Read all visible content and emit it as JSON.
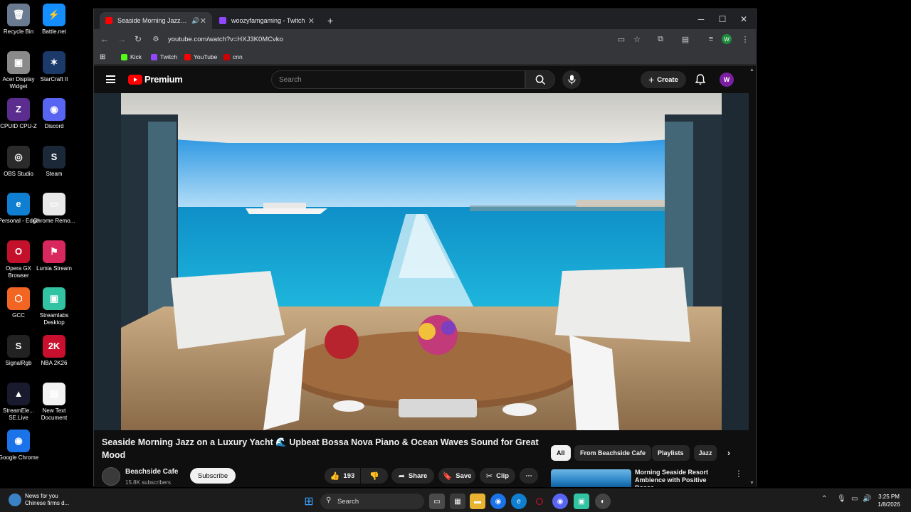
{
  "desktop_icons": [
    {
      "label": "Recycle Bin",
      "glyph": "🗑",
      "color": "#6a7a90"
    },
    {
      "label": "Battle.net",
      "glyph": "⚡",
      "color": "#148eff"
    },
    {
      "label": "Acer Display Widget",
      "glyph": "▣",
      "color": "#8a8a8a"
    },
    {
      "label": "StarCraft II",
      "glyph": "✶",
      "color": "#1b3a6a"
    },
    {
      "label": "CPUID CPU-Z",
      "glyph": "Z",
      "color": "#5b2d8e"
    },
    {
      "label": "Discord",
      "glyph": "◉",
      "color": "#5865f2"
    },
    {
      "label": "OBS Studio",
      "glyph": "◎",
      "color": "#2b2b2b"
    },
    {
      "label": "Steam",
      "glyph": "S",
      "color": "#1b2838"
    },
    {
      "label": "Personal - Edge",
      "glyph": "e",
      "color": "#0e7fd1"
    },
    {
      "label": "Chrome Remo...",
      "glyph": "▭",
      "color": "#e8e8e8"
    },
    {
      "label": "Opera GX Browser",
      "glyph": "O",
      "color": "#c3102b"
    },
    {
      "label": "Lumia Stream",
      "glyph": "⚑",
      "color": "#d9285e"
    },
    {
      "label": "GCC",
      "glyph": "⬡",
      "color": "#f26522"
    },
    {
      "label": "Streamlabs Desktop",
      "glyph": "▣",
      "color": "#31c3a2"
    },
    {
      "label": "SignalRgb",
      "glyph": "S",
      "color": "#222"
    },
    {
      "label": "NBA 2K26",
      "glyph": "2K",
      "color": "#c8102e"
    },
    {
      "label": "StreamEle... SE.Live",
      "glyph": "▲",
      "color": "#1a1a2e"
    },
    {
      "label": "New Text Document",
      "glyph": "▤",
      "color": "#f2f2f2"
    },
    {
      "label": "Google Chrome",
      "glyph": "◉",
      "color": "#1a73e8"
    }
  ],
  "browser": {
    "tabs": [
      {
        "title": "Seaside Morning Jazz on a",
        "favicon_color": "#ff0000",
        "active": true,
        "audio_icon": "speaker-icon"
      },
      {
        "title": "woozyfamgaming - Twitch",
        "favicon_color": "#9146ff",
        "active": false
      }
    ],
    "new_tab_label": "+",
    "url": "youtube.com/watch?v=HXJ3K0MCvko",
    "profile_letter": "W",
    "bookmarks": [
      {
        "label": "Kick",
        "color": "#53fc18"
      },
      {
        "label": "Twitch",
        "color": "#9146ff"
      },
      {
        "label": "YouTube",
        "color": "#ff0000"
      },
      {
        "label": "cnn",
        "color": "#cc0000"
      }
    ]
  },
  "youtube": {
    "logo_text": "Premium",
    "search_placeholder": "Search",
    "create_label": "Create",
    "avatar_letter": "W",
    "video_title": "Seaside Morning Jazz on a Luxury Yacht 🌊 Upbeat Bossa Nova Piano & Ocean Waves Sound for Great Mood",
    "channel_name": "Beachside Cafe",
    "subscribers": "15.8K subscribers",
    "subscribe_label": "Subscribe",
    "likes": "193",
    "share_label": "Share",
    "save_label": "Save",
    "clip_label": "Clip",
    "chips": [
      "All",
      "From Beachside Cafe",
      "Playlists",
      "Jazz"
    ],
    "recommendation_title": "Morning Seaside Resort Ambience with Positive Bossa"
  },
  "taskbar": {
    "news_title": "News for you",
    "news_subtitle": "Chinese firms d...",
    "search_label": "Search",
    "time": "3:25 PM",
    "date": "1/8/2026"
  },
  "colors": {
    "yt_red": "#ff0000",
    "yt_bg": "#0f0f0f",
    "chrome_toolbar": "#35363a"
  }
}
